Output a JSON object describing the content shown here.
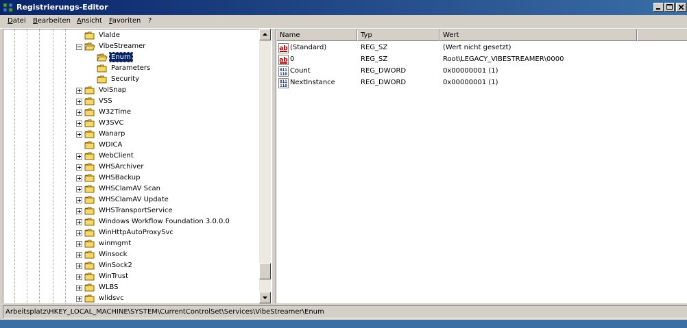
{
  "window": {
    "title": "Registrierungs-Editor"
  },
  "menu": [
    {
      "label": "Datei"
    },
    {
      "label": "Bearbeiten"
    },
    {
      "label": "Ansicht"
    },
    {
      "label": "Favoriten"
    },
    {
      "label": "?"
    }
  ],
  "tree": {
    "items": [
      {
        "label": "ViaIde",
        "level": 1,
        "expander": "none",
        "open": false
      },
      {
        "label": "VibeStreamer",
        "level": 1,
        "expander": "minus",
        "open": true
      },
      {
        "label": "Enum",
        "level": 2,
        "expander": "none",
        "open": true,
        "selected": true
      },
      {
        "label": "Parameters",
        "level": 2,
        "expander": "none",
        "open": false
      },
      {
        "label": "Security",
        "level": 2,
        "expander": "none",
        "open": false
      },
      {
        "label": "VolSnap",
        "level": 1,
        "expander": "plus",
        "open": false
      },
      {
        "label": "VSS",
        "level": 1,
        "expander": "plus",
        "open": false
      },
      {
        "label": "W32Time",
        "level": 1,
        "expander": "plus",
        "open": false
      },
      {
        "label": "W3SVC",
        "level": 1,
        "expander": "plus",
        "open": false
      },
      {
        "label": "Wanarp",
        "level": 1,
        "expander": "plus",
        "open": false
      },
      {
        "label": "WDICA",
        "level": 1,
        "expander": "none",
        "open": false
      },
      {
        "label": "WebClient",
        "level": 1,
        "expander": "plus",
        "open": false
      },
      {
        "label": "WHSArchiver",
        "level": 1,
        "expander": "plus",
        "open": false
      },
      {
        "label": "WHSBackup",
        "level": 1,
        "expander": "plus",
        "open": false
      },
      {
        "label": "WHSClamAV Scan",
        "level": 1,
        "expander": "plus",
        "open": false
      },
      {
        "label": "WHSClamAV Update",
        "level": 1,
        "expander": "plus",
        "open": false
      },
      {
        "label": "WHSTransportService",
        "level": 1,
        "expander": "plus",
        "open": false
      },
      {
        "label": "Windows Workflow Foundation 3.0.0.0",
        "level": 1,
        "expander": "plus",
        "open": false
      },
      {
        "label": "WinHttpAutoProxySvc",
        "level": 1,
        "expander": "plus",
        "open": false
      },
      {
        "label": "winmgmt",
        "level": 1,
        "expander": "plus",
        "open": false
      },
      {
        "label": "Winsock",
        "level": 1,
        "expander": "plus",
        "open": false
      },
      {
        "label": "WinSock2",
        "level": 1,
        "expander": "plus",
        "open": false
      },
      {
        "label": "WinTrust",
        "level": 1,
        "expander": "plus",
        "open": false
      },
      {
        "label": "WLBS",
        "level": 1,
        "expander": "plus",
        "open": false
      },
      {
        "label": "wlidsvc",
        "level": 1,
        "expander": "plus",
        "open": false
      }
    ]
  },
  "values": {
    "columns": {
      "name": "Name",
      "type": "Typ",
      "value": "Wert"
    },
    "rows": [
      {
        "name": "(Standard)",
        "type": "REG_SZ",
        "value": "(Wert nicht gesetzt)",
        "icon": "string-value-icon"
      },
      {
        "name": "0",
        "type": "REG_SZ",
        "value": "Root\\LEGACY_VIBESTREAMER\\0000",
        "icon": "string-value-icon"
      },
      {
        "name": "Count",
        "type": "REG_DWORD",
        "value": "0x00000001 (1)",
        "icon": "binary-value-icon"
      },
      {
        "name": "NextInstance",
        "type": "REG_DWORD",
        "value": "0x00000001 (1)",
        "icon": "binary-value-icon"
      }
    ]
  },
  "status": {
    "path": "Arbeitsplatz\\HKEY_LOCAL_MACHINE\\SYSTEM\\CurrentControlSet\\Services\\VibeStreamer\\Enum"
  },
  "colors": {
    "titlebar": "#0a246a",
    "selection": "#0a246a",
    "folder": "#f5d76e",
    "window_bg": "#d4d0c8"
  }
}
